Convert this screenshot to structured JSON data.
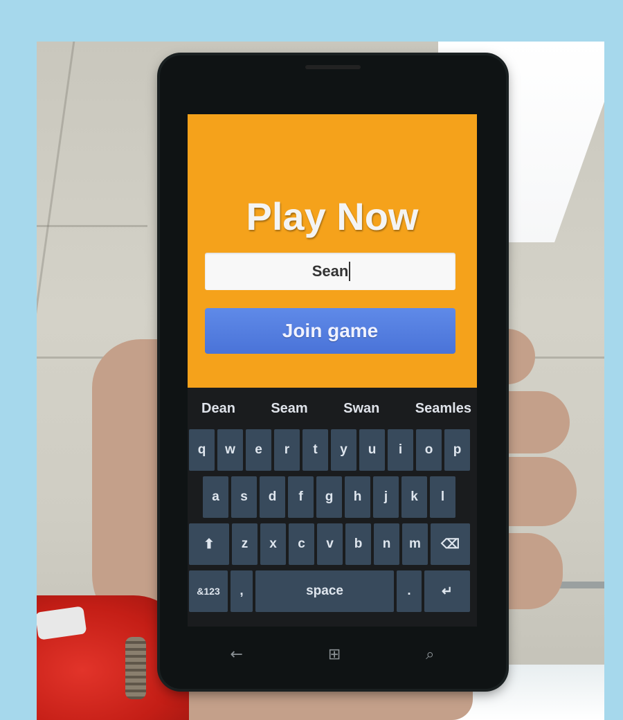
{
  "app": {
    "title": "Play Now",
    "name_value": "Sean",
    "join_label": "Join game"
  },
  "suggestions": [
    "Dean",
    "Seam",
    "Swan",
    "Seamles"
  ],
  "keyboard": {
    "row1": [
      "q",
      "w",
      "e",
      "r",
      "t",
      "y",
      "u",
      "i",
      "o",
      "p"
    ],
    "row2": [
      "a",
      "s",
      "d",
      "f",
      "g",
      "h",
      "j",
      "k",
      "l"
    ],
    "row3": [
      "z",
      "x",
      "c",
      "v",
      "b",
      "n",
      "m"
    ],
    "shift_glyph": "⬆",
    "backspace_glyph": "⌫",
    "symbols_label": "&123",
    "comma_label": ",",
    "space_label": "space",
    "period_label": ".",
    "enter_glyph": "↵"
  },
  "navbar": {
    "back_glyph": "←",
    "windows_glyph": "⊞",
    "search_glyph": "⌕"
  },
  "colors": {
    "app_background": "#f5a21b",
    "join_button": "#4a73d8",
    "key_background": "#384a5c",
    "page_border": "#a6d8ec"
  }
}
